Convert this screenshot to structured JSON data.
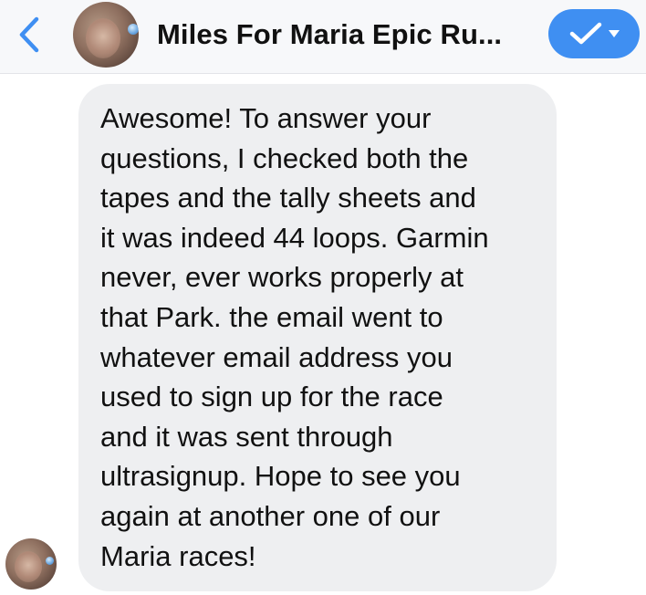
{
  "header": {
    "back_icon": "chevron-left-icon",
    "title": "Miles For Maria Epic Ru...",
    "status_icons": [
      "checkmark-icon",
      "caret-down-icon"
    ],
    "accent_color": "#3f8ff2"
  },
  "message": {
    "text": "Awesome! To answer your\nquestions, I checked both the\ntapes and the tally sheets and\nit was indeed 44 loops. Garmin\nnever, ever works properly at\nthat Park. the email went to\nwhatever email address you\nused to sign up for the race\nand it was sent through\nultrasignup. Hope to see you\nagain at another one of our\nMaria races!",
    "bubble_color": "#eeeff1"
  }
}
